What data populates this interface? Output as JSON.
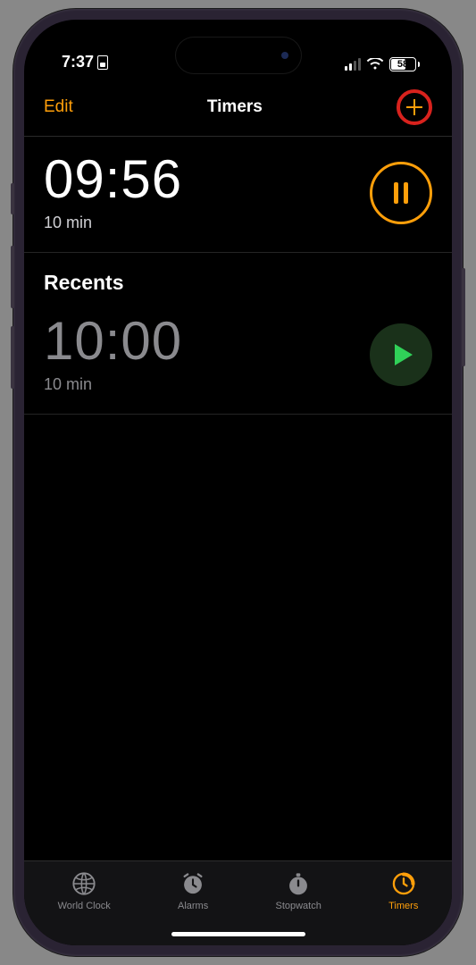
{
  "status": {
    "time": "7:37",
    "battery": "58"
  },
  "header": {
    "edit_label": "Edit",
    "title": "Timers"
  },
  "active_timer": {
    "time": "09:56",
    "label": "10 min"
  },
  "recents": {
    "title": "Recents",
    "items": [
      {
        "time": "10:00",
        "label": "10 min"
      }
    ]
  },
  "tabs": {
    "world_clock": "World Clock",
    "alarms": "Alarms",
    "stopwatch": "Stopwatch",
    "timers": "Timers"
  },
  "colors": {
    "accent": "#ff9f0a",
    "green": "#30d158",
    "annotation": "#d8221d"
  }
}
